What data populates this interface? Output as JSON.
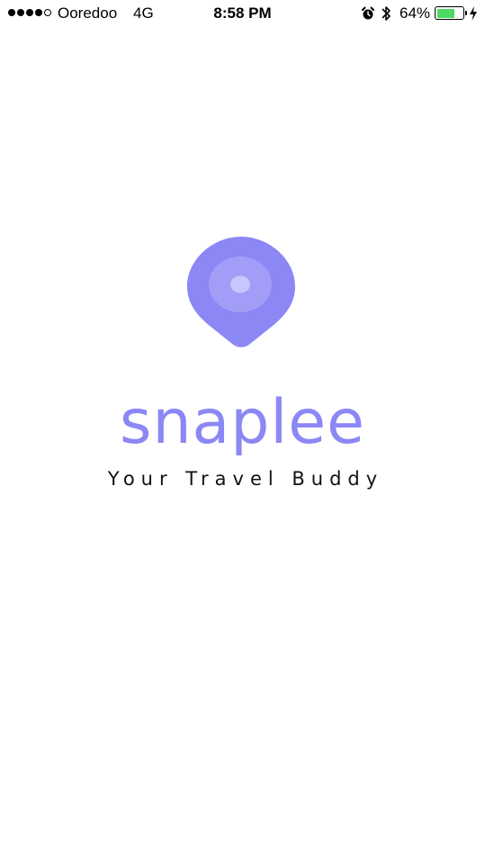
{
  "status_bar": {
    "carrier": "Ooredoo",
    "network": "4G",
    "time": "8:58 PM",
    "battery_percent": "64%",
    "battery_level": 0.64,
    "signal_bars_filled": 4,
    "signal_bars_total": 5,
    "battery_fill_color": "#4cd964",
    "icons": [
      "alarm-icon",
      "bluetooth-icon",
      "battery-icon",
      "charging-icon"
    ]
  },
  "splash": {
    "brand_name": "snaplee",
    "tagline": "Your Travel Buddy",
    "brand_color": "#8b87f5",
    "logo_icon": "map-pin-icon"
  }
}
